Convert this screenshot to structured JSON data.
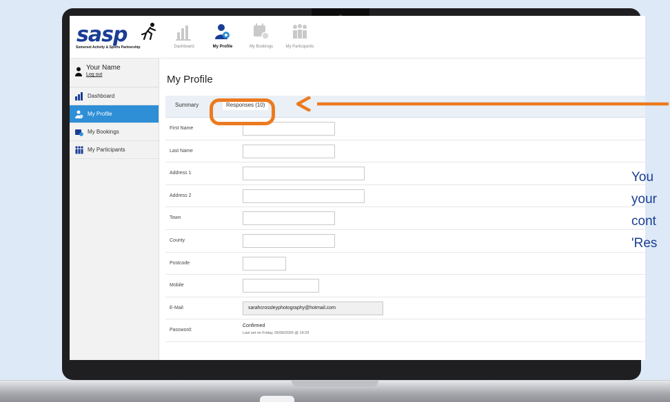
{
  "header": {
    "logo_text": "sasp",
    "logo_subtitle": "Somerset Activity & Sports Partnership",
    "nav": [
      {
        "label": "Dashboard",
        "icon": "bar-chart-icon",
        "active": false
      },
      {
        "label": "My Profile",
        "icon": "user-gear-icon",
        "active": true
      },
      {
        "label": "My Bookings",
        "icon": "calendar-icon",
        "active": false
      },
      {
        "label": "My Participants",
        "icon": "group-icon",
        "active": false
      }
    ]
  },
  "sidebar": {
    "user_name": "Your Name",
    "logout_label": "Log out",
    "items": [
      {
        "label": "Dashboard",
        "icon": "bar-chart-icon"
      },
      {
        "label": "My Profile",
        "icon": "user-gear-icon"
      },
      {
        "label": "My Bookings",
        "icon": "calendar-icon"
      },
      {
        "label": "My Participants",
        "icon": "group-icon"
      }
    ]
  },
  "main": {
    "title": "My Profile",
    "tabs": [
      "Summary",
      "Responses (10)"
    ],
    "fields": [
      {
        "label": "First Name",
        "value": ""
      },
      {
        "label": "Last Name",
        "value": ""
      },
      {
        "label": "Address 1",
        "value": ""
      },
      {
        "label": "Address 2",
        "value": ""
      },
      {
        "label": "Town",
        "value": ""
      },
      {
        "label": "County",
        "value": ""
      },
      {
        "label": "Postcode",
        "value": ""
      },
      {
        "label": "Mobile",
        "value": ""
      },
      {
        "label": "E-Mail",
        "value": "sarahcrossleyphotography@hotmail.com"
      }
    ],
    "password": {
      "label": "Password:",
      "status": "Confirmed",
      "last_set": "Last set on Friday, 05/06/2026 @ 14:29"
    }
  },
  "annotation": {
    "lines": [
      "You",
      "your",
      "cont",
      "'Res"
    ]
  },
  "colors": {
    "accent": "#2e8ed6",
    "highlight": "#ec7a1f",
    "brand": "#1a3d94",
    "background": "#dde9f7"
  }
}
